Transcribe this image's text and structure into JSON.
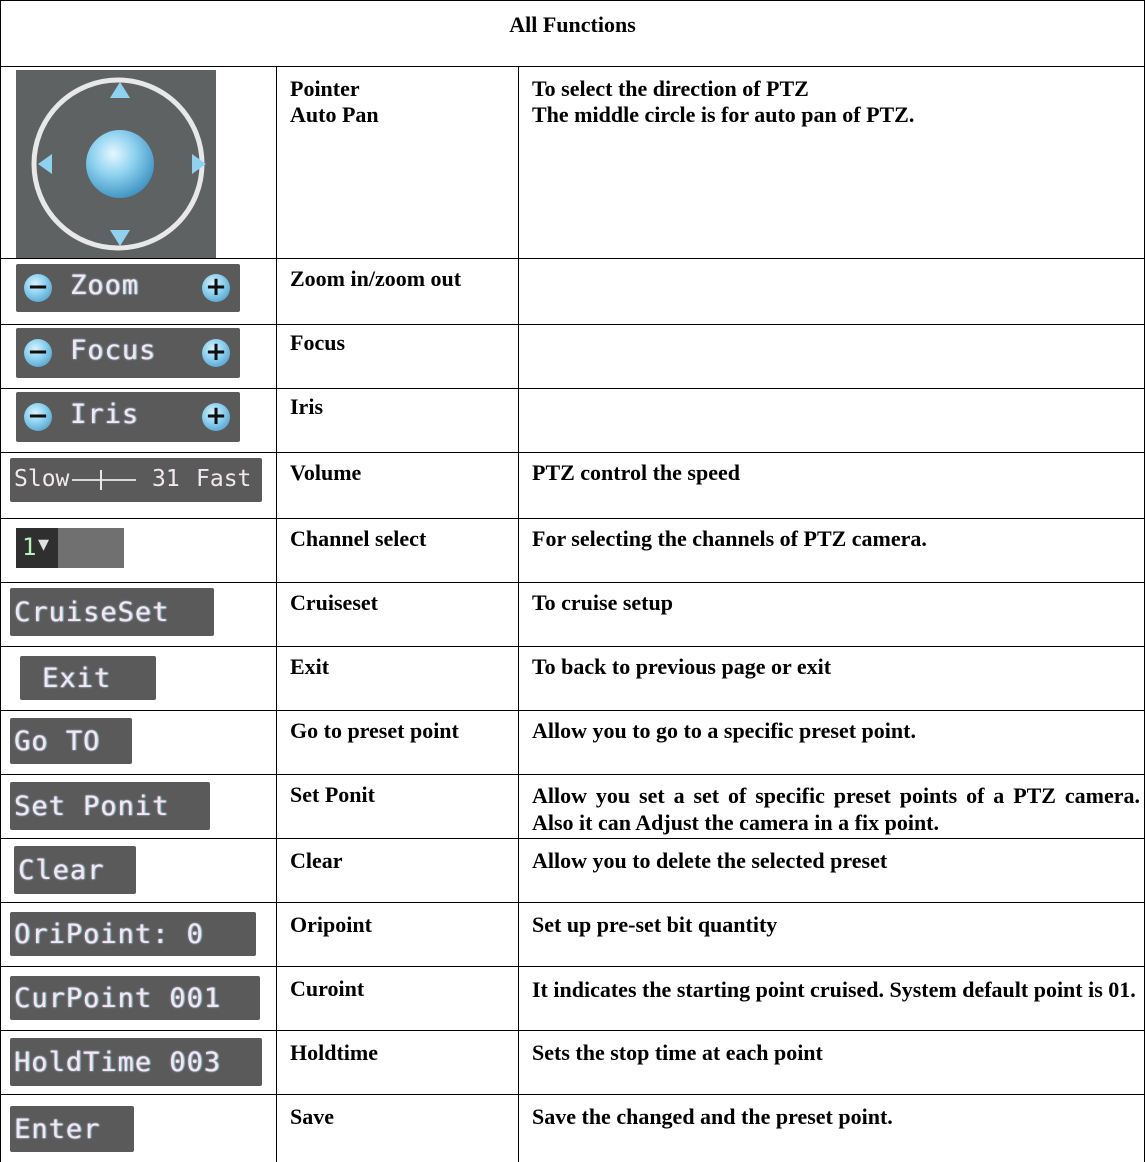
{
  "table": {
    "title": "All Functions",
    "rows": [
      {
        "name": "Pointer",
        "name2": "Auto Pan",
        "desc": "To select the direction of PTZ",
        "desc2": "The middle circle is for auto pan of PTZ."
      },
      {
        "name": "Zoom in/zoom out",
        "desc": ""
      },
      {
        "name": "Focus",
        "desc": ""
      },
      {
        "name": "Iris",
        "desc": ""
      },
      {
        "name": "Volume",
        "desc": "PTZ control the speed"
      },
      {
        "name": "Channel select",
        "desc": "For selecting the channels of PTZ camera."
      },
      {
        "name": "Cruiseset",
        "desc": "To cruise setup"
      },
      {
        "name": "Exit",
        "desc": "To back to previous page or exit"
      },
      {
        "name": "Go to preset point",
        "desc": "Allow you to go to a specific preset point."
      },
      {
        "name": "Set Ponit",
        "desc": "Allow you set a set of specific preset points of a PTZ camera. Also it can Adjust the camera in a fix point."
      },
      {
        "name": "Clear",
        "desc": "Allow you to delete the selected preset"
      },
      {
        "name": "Oripoint",
        "desc": "Set up pre-set bit quantity"
      },
      {
        "name": "Curoint",
        "desc": "It indicates the starting point cruised. System default point is 01."
      },
      {
        "name": "Holdtime",
        "desc": "Sets the stop time at each point"
      },
      {
        "name": "Save",
        "desc": "Save the changed and the preset point."
      }
    ]
  },
  "controls": {
    "zoom": "Zoom",
    "focus": "Focus",
    "iris": "Iris",
    "speed_slow": "Slow",
    "speed_value": "31",
    "speed_fast": "Fast",
    "channel_value": "1",
    "cruiseset": "CruiseSet",
    "exit": "Exit",
    "goto": "Go TO",
    "set_point": "Set Ponit",
    "clear": "Clear",
    "oripoint": "OriPoint: 0",
    "curpoint": "CurPoint 001",
    "holdtime": "HoldTime 003",
    "enter": "Enter",
    "minus_glyph": "−",
    "plus_glyph": "+",
    "dropdown_glyph": "▾"
  },
  "colors": {
    "chip_bg": "#5a5a5a",
    "chip_text": "#f2e8f0",
    "ptz_blue": "#8fd2f0"
  }
}
